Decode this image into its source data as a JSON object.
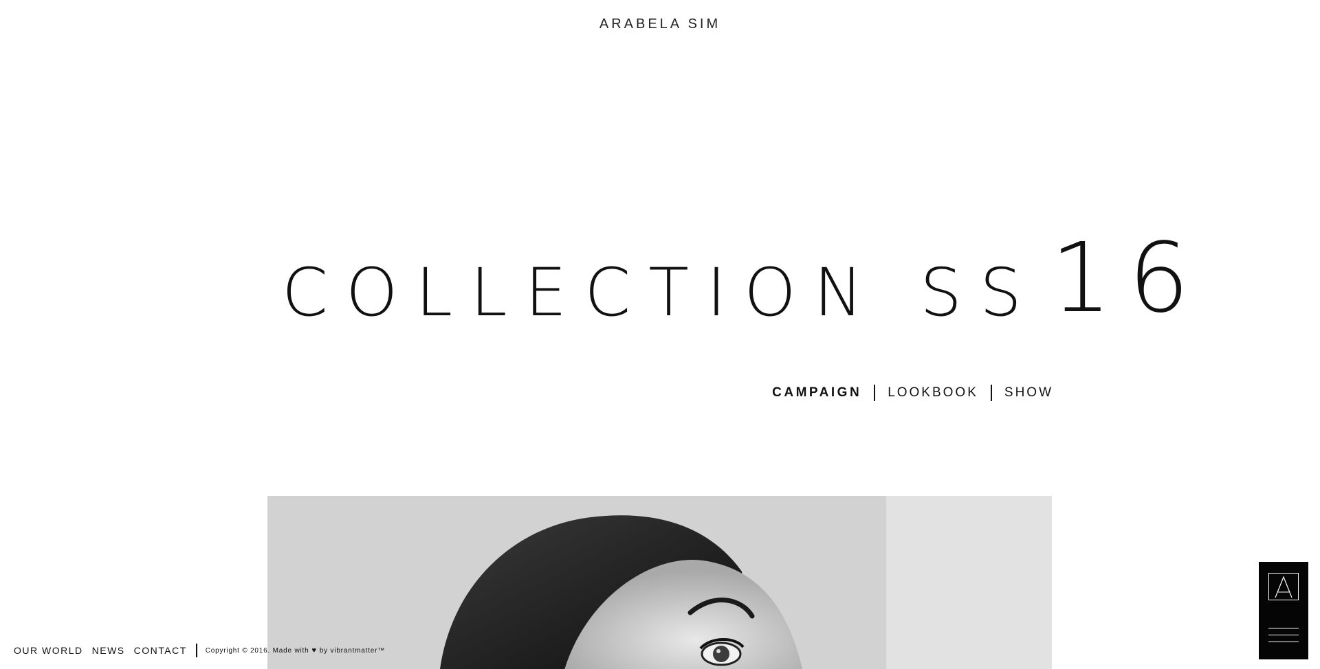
{
  "brand": {
    "name": "ARABELA SIM"
  },
  "headline": {
    "words": "COLLECTION SS",
    "year": "16"
  },
  "subnav": {
    "items": [
      {
        "label": "CAMPAIGN",
        "active": true
      },
      {
        "label": "LOOKBOOK",
        "active": false
      },
      {
        "label": "SHOW",
        "active": false
      }
    ]
  },
  "footer": {
    "links": [
      {
        "label": "OUR WORLD"
      },
      {
        "label": "NEWS"
      },
      {
        "label": "CONTACT"
      }
    ],
    "copyright_prefix": "Copyright © 2016. Made with",
    "copyright_suffix": "by vibrantmatter™"
  },
  "menu": {
    "logo_icon": "arabela-logo-icon",
    "menu_icon": "hamburger-menu-icon"
  },
  "colors": {
    "background": "#ffffff",
    "text": "#111111",
    "menu_box": "#050505"
  }
}
